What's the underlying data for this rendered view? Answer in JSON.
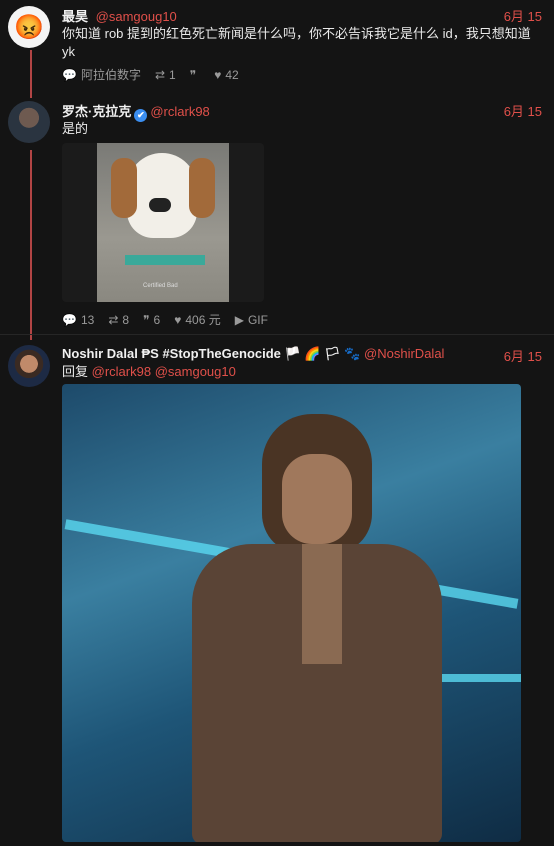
{
  "post1": {
    "avatar_emoji": "😡",
    "name": "最昊",
    "handle": "@samgoug10",
    "date": "6月 15",
    "text": "你知道 rob 提到的红色死亡新闻是什么吗，你不必告诉我它是什么 id，我只想知道 yk",
    "stats": {
      "replies": "阿拉伯数字",
      "reposts": "1",
      "quotes": "",
      "likes": "42"
    }
  },
  "post2": {
    "name": "罗杰·克拉克",
    "verified_icon": "✔",
    "handle": "@rclark98",
    "date": "6月 15",
    "text": "是的",
    "media_caption": "Certified Bad",
    "stats": {
      "replies": "13",
      "reposts": "8",
      "quotes": "6",
      "likes": "406 元",
      "gif": "GIF"
    }
  },
  "post3": {
    "name": "Noshir Dalal",
    "name_extra": "₱S #StopTheGenocide 🏳️ 🌈 🏳 🐾",
    "handle": "@NoshirDalal",
    "date": "6月 15",
    "reply_prefix": "回复",
    "mention1": "@rclark98",
    "mention2": "@samgoug10"
  },
  "colors": {
    "accent": "#e0504a",
    "thread": "#b24545",
    "bg": "#141414"
  }
}
